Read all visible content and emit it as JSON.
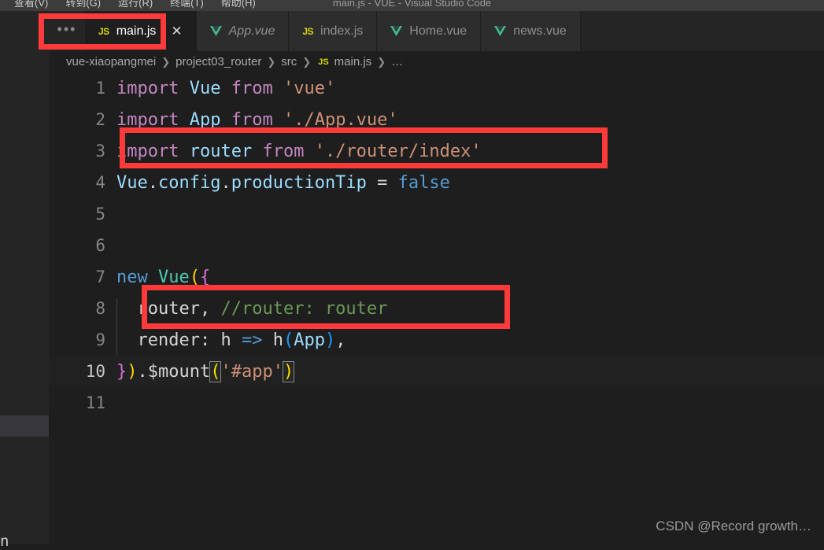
{
  "window": {
    "title": "main.js - VUE - Visual Studio Code",
    "menu": [
      {
        "label": "查看(V)"
      },
      {
        "label": "转到(G)"
      },
      {
        "label": "运行(R)"
      },
      {
        "label": "终端(T)"
      },
      {
        "label": "帮助(H)"
      }
    ]
  },
  "tabs": {
    "overflow_label": "•••",
    "items": [
      {
        "label": "main.js",
        "icon": "js-file-icon",
        "active": true,
        "preview": false,
        "close_label": "✕"
      },
      {
        "label": "App.vue",
        "icon": "vue-file-icon",
        "active": false,
        "preview": true
      },
      {
        "label": "index.js",
        "icon": "js-file-icon",
        "active": false,
        "preview": false
      },
      {
        "label": "Home.vue",
        "icon": "vue-file-icon",
        "active": false,
        "preview": false
      },
      {
        "label": "news.vue",
        "icon": "vue-file-icon",
        "active": false,
        "preview": false
      }
    ]
  },
  "breadcrumb": {
    "separator": "❯",
    "parts": [
      {
        "label": "vue-xiaopangmei",
        "icon": ""
      },
      {
        "label": "project03_router",
        "icon": ""
      },
      {
        "label": "src",
        "icon": ""
      },
      {
        "label": "main.js",
        "icon": "js-file-icon"
      },
      {
        "label": "…",
        "icon": ""
      }
    ]
  },
  "editor": {
    "language": "javascript",
    "active_line": 10,
    "lines": [
      {
        "no": "1",
        "text": "import Vue from 'vue'"
      },
      {
        "no": "2",
        "text": "import App from './App.vue'"
      },
      {
        "no": "3",
        "text": "import router from './router/index'"
      },
      {
        "no": "4",
        "text": "Vue.config.productionTip = false"
      },
      {
        "no": "5",
        "text": ""
      },
      {
        "no": "6",
        "text": ""
      },
      {
        "no": "7",
        "text": "new Vue({"
      },
      {
        "no": "8",
        "text": "  router, //router: router"
      },
      {
        "no": "9",
        "text": "  render: h => h(App),"
      },
      {
        "no": "10",
        "text": "}).$mount('#app')"
      },
      {
        "no": "11",
        "text": ""
      }
    ]
  },
  "annotations": [
    {
      "name": "main-js-tab-highlight",
      "target": "tab main.js"
    },
    {
      "name": "import-router-highlight",
      "target": "line 3"
    },
    {
      "name": "router-option-highlight",
      "target": "line 8"
    }
  ],
  "watermark": {
    "text": "CSDN @Record growth…"
  },
  "colors": {
    "annotation": "#ff3a3a",
    "editor_background": "#1e1e1e",
    "sidebar_background": "#252526",
    "tabbar_background": "#252526",
    "titlebar_background": "#3c3c3c",
    "keyword": "#569cd6",
    "string": "#ce9178",
    "comment": "#6a9955",
    "identifier": "#9cdcfe",
    "js_icon": "#d7d700",
    "vue_icon": "#41b883"
  }
}
